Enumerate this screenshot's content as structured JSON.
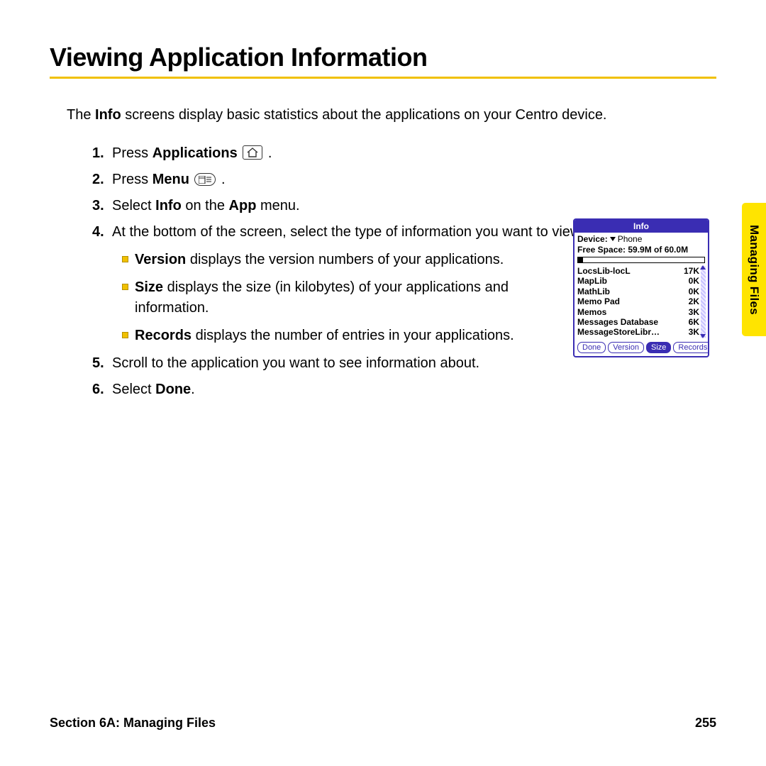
{
  "heading": "Viewing Application Information",
  "intro_pre": "The ",
  "intro_bold": "Info",
  "intro_post": " screens display basic statistics about the applications on your Centro device.",
  "steps": {
    "s1_pre": "Press ",
    "s1_bold": "Applications",
    "s1_post": " ",
    "s2_pre": "Press ",
    "s2_bold": "Menu",
    "s2_post": " ",
    "s3_pre": "Select ",
    "s3_bold1": "Info",
    "s3_mid": " on the ",
    "s3_bold2": "App",
    "s3_post": " menu.",
    "s4": "At the bottom of the screen, select the type of information you want to view:",
    "s5": "Scroll to the application you want to see information about.",
    "s6_pre": "Select ",
    "s6_bold": "Done",
    "s6_post": "."
  },
  "sub": {
    "v_bold": "Version",
    "v_text": " displays the version numbers of your applications.",
    "s_bold": "Size",
    "s_text": " displays the size (in kilobytes) of your applications and information.",
    "r_bold": "Records",
    "r_text": " displays the number of entries in your applications."
  },
  "sideTab": "Managing Files",
  "palm": {
    "title": "Info",
    "deviceLabel": "Device:",
    "deviceValue": "Phone",
    "freeSpace": "Free Space: 59.9M of 60.0M",
    "apps": [
      {
        "name": "LocsLib-locL",
        "size": "17K"
      },
      {
        "name": "MapLib",
        "size": "0K"
      },
      {
        "name": "MathLib",
        "size": "0K"
      },
      {
        "name": "Memo Pad",
        "size": "2K"
      },
      {
        "name": "Memos",
        "size": "3K"
      },
      {
        "name": "Messages Database",
        "size": "6K"
      },
      {
        "name": "MessageStoreLibr…",
        "size": "3K"
      }
    ],
    "buttons": {
      "done": "Done",
      "version": "Version",
      "size": "Size",
      "records": "Records"
    }
  },
  "footer": {
    "section": "Section 6A: Managing Files",
    "page": "255"
  }
}
